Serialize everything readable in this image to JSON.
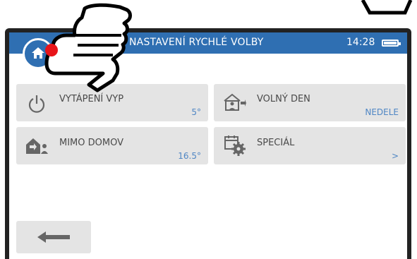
{
  "header": {
    "title": "NASTAVENÍ RYCHLÉ VOLBY",
    "time": "14:28"
  },
  "tiles": [
    {
      "label": "VYTÁPENÍ VYP",
      "value": "5°"
    },
    {
      "label": "VOLNÝ DEN",
      "value": "NEDELE"
    },
    {
      "label": "MIMO DOMOV",
      "value": "16.5°"
    },
    {
      "label": "SPECIÁL",
      "value": ">"
    }
  ],
  "colors": {
    "accent": "#2f6fb2",
    "tile": "#e4e4e4",
    "value": "#4f86c4",
    "touch_dot": "#e8141a"
  },
  "icons": [
    "home-icon",
    "power-icon",
    "house-person-icon",
    "calendar-gear-icon",
    "arrow-left-icon",
    "battery-icon",
    "pointing-hand-icon"
  ]
}
